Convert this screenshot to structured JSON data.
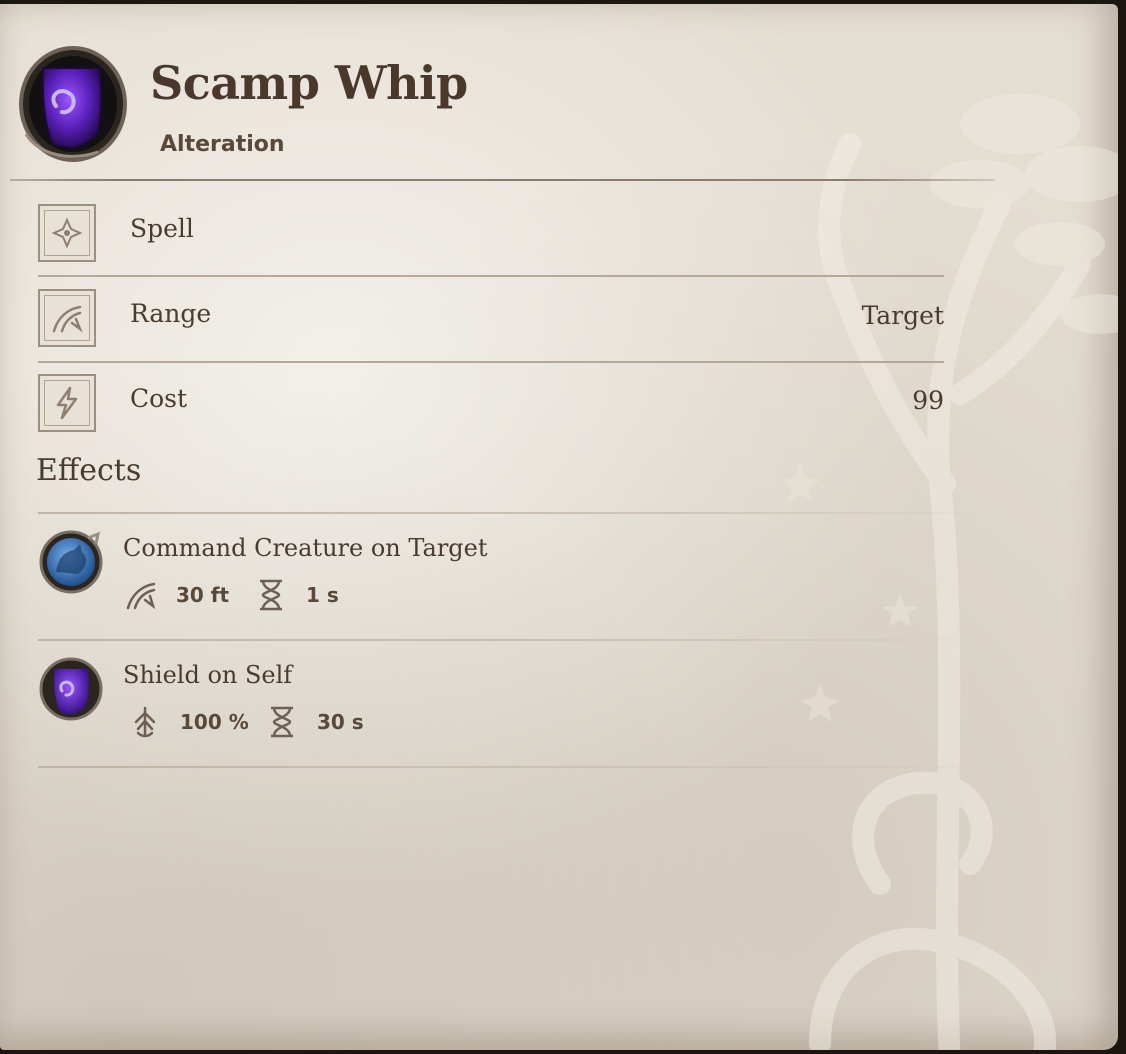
{
  "header": {
    "title": "Scamp Whip",
    "school": "Alteration",
    "icon": "shield-spell-icon"
  },
  "properties": [
    {
      "label": "Spell",
      "value": "",
      "icon": "spell-rune-icon"
    },
    {
      "label": "Range",
      "value": "Target",
      "icon": "range-arrow-icon"
    },
    {
      "label": "Cost",
      "value": "99",
      "icon": "lightning-cost-icon"
    }
  ],
  "effects_heading": "Effects",
  "effects": [
    {
      "name": "Command Creature on Target",
      "icon": "command-creature-icon",
      "stats": [
        {
          "icon": "range-arrow-icon",
          "value": "30 ft"
        },
        {
          "icon": "hourglass-icon",
          "value": "1 s"
        }
      ]
    },
    {
      "name": "Shield on Self",
      "icon": "shield-spell-icon",
      "stats": [
        {
          "icon": "magnitude-icon",
          "value": "100 %"
        },
        {
          "icon": "hourglass-icon",
          "value": "30 s"
        }
      ]
    }
  ],
  "colors": {
    "parchment": "#e4ddd2",
    "ink": "#4a3b2f",
    "spell_purple": "#6a2bd1",
    "frame_dark": "#2b2520"
  }
}
